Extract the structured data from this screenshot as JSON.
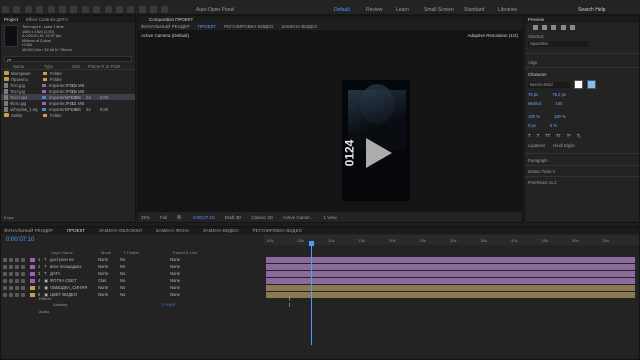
{
  "toolbar": {
    "auto_open": "Auto-Open Panel",
    "workspaces": [
      "Default",
      "Review",
      "Learn",
      "Small Screen",
      "Standard",
      "Libraries"
    ],
    "search": "Search Help"
  },
  "project": {
    "tab_project": "Project",
    "tab_effects": "Effect Controls ДАТА",
    "info_name": "Тест.mp4 ▾ , used 1 time",
    "info_lines": [
      "1080 x 1920 (1,00)",
      "Δ 0;00;21;15, 29,97 fps",
      "Millions of Colors",
      "H.264",
      "48,000 kHz / 32 bit U / Stereo"
    ],
    "search_placeholder": "ρ▾",
    "headers": {
      "name": "Name",
      "type": "Type",
      "size": "Size",
      "fps": "Frame R...",
      "in": "In Point"
    },
    "items": [
      {
        "name": "Материал",
        "kind": "folder",
        "type": "Folder",
        "size": "",
        "fps": "",
        "in": "",
        "color": "#c8a04a"
      },
      {
        "name": "Проекты",
        "kind": "folder",
        "type": "Folder",
        "size": "",
        "fps": "",
        "in": "",
        "color": "#c8a04a"
      },
      {
        "name": "Тест.jpg",
        "kind": "file",
        "type": "ImporterJPEG",
        "size": "1,8 MB",
        "fps": "",
        "in": "",
        "color": "#a35fb5"
      },
      {
        "name": "Тест.jpg",
        "kind": "file",
        "type": "ImporterJPEG",
        "size": "1,8 MB",
        "fps": "",
        "in": "",
        "color": "#a35fb5"
      },
      {
        "name": "Тест.mp4",
        "kind": "file",
        "type": "ImporterMPEG",
        "size": "...MB",
        "fps": "24",
        "in": "0;00",
        "color": "#4a86c8"
      },
      {
        "name": "Фото.jpg",
        "kind": "file",
        "type": "ImporterJPEG",
        "size": "1,1 MB",
        "fps": "",
        "in": "",
        "color": "#a35fb5"
      },
      {
        "name": "ukhrydrw_1.mp4",
        "kind": "file",
        "type": "ImporterMPEG",
        "size": "...MB",
        "fps": "24",
        "in": "0;00",
        "color": "#4a86c8"
      },
      {
        "name": "Solids",
        "kind": "folder",
        "type": "Folder",
        "size": "",
        "fps": "",
        "in": "",
        "color": "#c8a04a"
      }
    ],
    "footer": "8 bpc"
  },
  "viewer": {
    "panel_title": "Composition ПРОЕКТ",
    "tabs": [
      "ФИНАЛЬНЫЙ РЕНДЕР",
      "ПРОЕКТ",
      "РЕГУЛИРОВКА ВИДЕО",
      "ЗАМЕНА ВИДЕО"
    ],
    "camera": "Active Camera (Default)",
    "renderer": "Adaptive Resolution (1/2)",
    "overlay_text": "0124",
    "zoom": "25%",
    "quality": "Full",
    "timecode": "0:00:07:10",
    "draft": "Draft 3D",
    "renderer_mode": "Classic 3D",
    "camera_select": "Active Camer...",
    "views": "1 View"
  },
  "right_panel": {
    "preview_tab": "Preview",
    "shortcut_label": "Shortcut",
    "shortcut_value": "Spacebar",
    "align_label": "Align",
    "character_label": "Character",
    "font_name": "Benzin-Bold",
    "font_size": "75 px",
    "leading": "75,2 px",
    "kerning_mode": "Metrics",
    "tracking": "100",
    "vscale": "100 %",
    "hscale": "100 %",
    "baseline": "0 px",
    "tsume": "0 %",
    "ligatures": "Ligatures",
    "hindi_digits": "Hindi Digits",
    "paragraph_label": "Paragraph",
    "motion_tools": "Motion Tools 2",
    "free_react": "FreeReact v1.2"
  },
  "timeline": {
    "tabs": [
      "ФИНАЛЬНЫЙ РЕНДЕР",
      "ПРОЕКТ",
      "ЗАМЕНА ОБЛОЖКИ",
      "ЗАМЕНА ФОНА",
      "ЗАМЕНА ВИДЕО",
      "РЕГУЛИРОВКА ВИДЕО"
    ],
    "timecode": "0:00:07:10",
    "headers": {
      "name": "Layer Name",
      "mode": "Mode",
      "trkmat": "T TrkMat",
      "parent": "Parent & Link"
    },
    "layers": [
      {
        "num": "1",
        "name": "доступен на",
        "kind": "T",
        "mode": "Norm",
        "trk": "No",
        "parent": "None",
        "label": "#a35fb5"
      },
      {
        "num": "2",
        "name": "всех площадках",
        "kind": "T",
        "mode": "Norm",
        "trk": "No",
        "parent": "None",
        "label": "#a35fb5"
      },
      {
        "num": "3",
        "name": "ДАТА",
        "kind": "T",
        "mode": "Norm",
        "trk": "No",
        "parent": "None",
        "label": "#a35fb5"
      },
      {
        "num": "4",
        "name": "ФОТКА СВЕТ",
        "kind": "▣",
        "mode": "Clas",
        "trk": "No",
        "parent": "None",
        "label": "#a35fb5"
      },
      {
        "num": "5",
        "name": "ОБВОДКА_СИНЯЯ",
        "kind": "▣",
        "mode": "Norm",
        "trk": "No",
        "parent": "None",
        "label": "#c8a04a"
      },
      {
        "num": "6",
        "name": "ЦВЕТ ВИДЕО",
        "kind": "▣",
        "mode": "Norm",
        "trk": "No",
        "parent": "None",
        "label": "#c8a04a"
      }
    ],
    "group_effects": "Effects",
    "group_autokey": "Autokey",
    "autokey_value": "7 / +0,0°",
    "group_audio": "Audio",
    "ruler": [
      "00s",
      "05s",
      "10s",
      "15s",
      "20s",
      "25s",
      "30s",
      "35s",
      "40s",
      "45s",
      "50s",
      "55s"
    ],
    "bar_colors": [
      "#8a6a9a",
      "#8a6a9a",
      "#8a6a9a",
      "#8a6a9a",
      "#8a7850",
      "#8a7850"
    ]
  }
}
